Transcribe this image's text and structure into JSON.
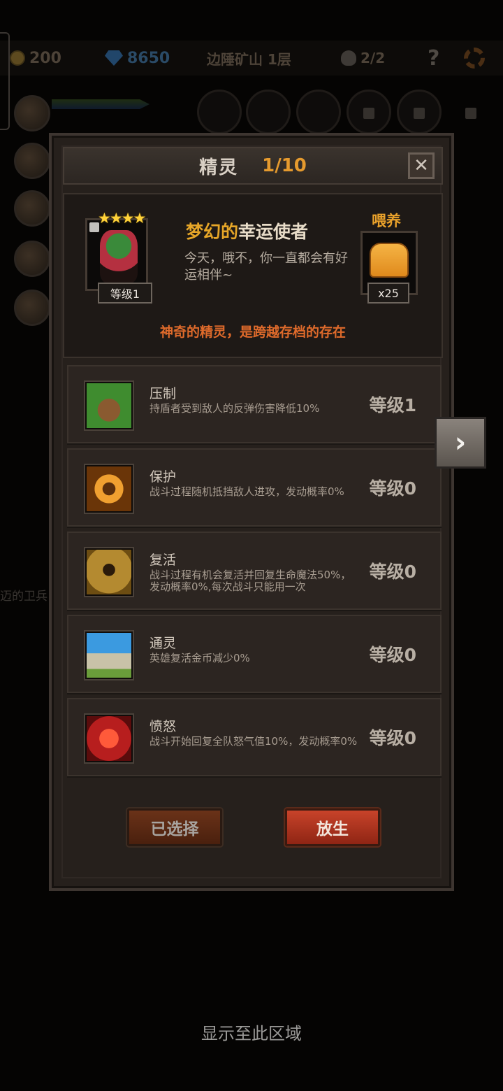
{
  "hud": {
    "gold": "200",
    "gems": "8650",
    "location": "边陲矿山 1层",
    "party": "2/2",
    "help": "?"
  },
  "background": {
    "partial_text": "迈的卫兵"
  },
  "panel": {
    "title": "精灵",
    "count": "1/10",
    "close_symbol": "✕"
  },
  "sprite": {
    "stars": "★★★★",
    "level": "等级1",
    "name_highlight": "梦幻的",
    "name_rest": "幸运使者",
    "description": "今天，哦不，你一直都会有好运相伴~",
    "feed_label": "喂养",
    "feed_count": "x25",
    "tagline": "神奇的精灵，是跨越存档的存在"
  },
  "skills": [
    {
      "name": "压制",
      "desc": "持盾者受到敌人的反弹伤害降低10%",
      "level": "等级1",
      "icon": "suppress-claw-icon"
    },
    {
      "name": "保护",
      "desc": "战斗过程随机抵挡敌人进攻，发动概率0%",
      "level": "等级0",
      "icon": "protect-fairy-icon"
    },
    {
      "name": "复活",
      "desc": "战斗过程有机会复活并回复生命魔法50%，发动概率0%,每次战斗只能用一次",
      "level": "等级0",
      "icon": "revive-figure-icon"
    },
    {
      "name": "通灵",
      "desc": "英雄复活金币减少0%",
      "level": "等级0",
      "icon": "spirit-tombstone-icon"
    },
    {
      "name": "愤怒",
      "desc": "战斗开始回复全队怒气值10%，发动概率0%",
      "level": "等级0",
      "icon": "rage-beast-icon"
    }
  ],
  "buttons": {
    "selected": "已选择",
    "release": "放生",
    "next": "›"
  },
  "footer": "显示至此区域",
  "colors": {
    "accent_orange": "#e59a2e",
    "tagline_red": "#de6a2b",
    "release_red": "#c8432a",
    "panel_bg": "#26201c"
  }
}
